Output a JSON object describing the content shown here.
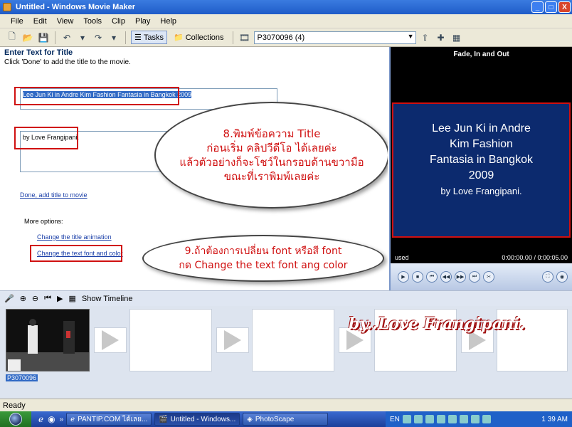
{
  "window": {
    "title": "Untitled - Windows Movie Maker",
    "buttons": [
      "_",
      "□",
      "X"
    ]
  },
  "menu": [
    "File",
    "Edit",
    "View",
    "Tools",
    "Clip",
    "Play",
    "Help"
  ],
  "toolbar": {
    "tasks_label": "Tasks",
    "collections_label": "Collections",
    "collection_value": "P3070096 (4)"
  },
  "left_pane": {
    "heading": "Enter Text for Title",
    "instruction": "Click 'Done' to add the title to the movie.",
    "title_text": "Lee Jun Ki in Andre Kim Fashion Fantasia in Bangkok 2009",
    "subtitle_text": "by Love Frangipani.",
    "done_link": "Done, add title to movie",
    "more_options_label": "More options:",
    "change_animation_link": "Change the title animation",
    "change_font_link": "Change the text font and color"
  },
  "bubbles": {
    "first": [
      "8.พิมพ์ข้อความ Title",
      "ก่อนเริ่ม คลิปวีดีโอ ได้เลยค่ะ",
      "แล้วตัวอย่างก็จะโชว์ในกรอบด้านขวามือ",
      "ขณะที่เราพิมพ์เลยค่ะ"
    ],
    "second": [
      "9.ถ้าต้องการเปลี่ยน font หรือสี font",
      "กด Change the text font ang color"
    ]
  },
  "preview": {
    "title": "Fade, In and Out",
    "card_lines": [
      "Lee Jun Ki in Andre",
      "Kim Fashion",
      "Fantasia in Bangkok",
      "2009"
    ],
    "card_by": "by Love Frangipani.",
    "status_left": "used",
    "status_time": "0:00:00.00 / 0:00:05.00"
  },
  "storyboard": {
    "show_timeline_label": "Show Timeline",
    "clip_label": "P3070096",
    "watermark": "by..Love Frangipani."
  },
  "status_bar": {
    "text": "Ready"
  },
  "taskbar": {
    "tasks": [
      "PANTIP.COM ได้เลย...",
      "Untitled - Windows...",
      "PhotoScape"
    ],
    "tray_lang": "EN",
    "clock": "1 39 AM"
  },
  "colors": {
    "title_bar": "#1f5cc8",
    "card_bg": "#0c2a6e",
    "annotation_red": "#d01010"
  }
}
